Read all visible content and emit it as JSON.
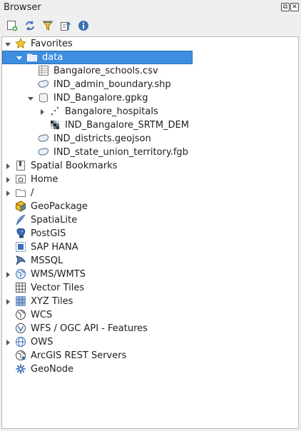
{
  "window": {
    "title": "Browser",
    "float_glyph": "⧉",
    "close_glyph": "✕"
  },
  "toolbar": {
    "buttons": [
      {
        "name": "add-layer-button",
        "icon": "add-layer-icon"
      },
      {
        "name": "refresh-button",
        "icon": "refresh-icon"
      },
      {
        "name": "filter-button",
        "icon": "filter-icon"
      },
      {
        "name": "collapse-all-button",
        "icon": "collapse-icon"
      },
      {
        "name": "properties-button",
        "icon": "info-icon"
      }
    ]
  },
  "tree": {
    "favorites": "Favorites",
    "data": "data",
    "schools_csv": "Bangalore_schools.csv",
    "admin_shp": "IND_admin_boundary.shp",
    "gpkg": "IND_Bangalore.gpkg",
    "hospitals": "Bangalore_hospitals",
    "srtm": "IND_Bangalore_SRTM_DEM",
    "districts": "IND_districts.geojson",
    "state_fgb": "IND_state_union_territory.fgb",
    "spatial_bookmarks": "Spatial Bookmarks",
    "home": "Home",
    "root": "/",
    "geopackage": "GeoPackage",
    "spatialite": "SpatiaLite",
    "postgis": "PostGIS",
    "sap_hana": "SAP HANA",
    "mssql": "MSSQL",
    "wms": "WMS/WMTS",
    "vector_tiles": "Vector Tiles",
    "xyz_tiles": "XYZ Tiles",
    "wcs": "WCS",
    "wfs": "WFS / OGC API - Features",
    "ows": "OWS",
    "arcgis": "ArcGIS REST Servers",
    "geonode": "GeoNode"
  },
  "colors": {
    "selection": "#3d8ee0",
    "accent_blue": "#3b6fb6",
    "star": "#f3c622"
  }
}
